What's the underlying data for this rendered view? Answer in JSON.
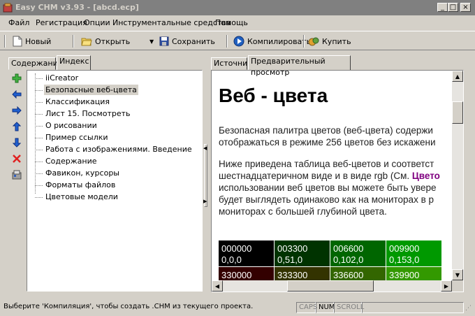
{
  "window": {
    "title": "Easy CHM v3.93 - [abcd.ecp]",
    "minimize_glyph": "_",
    "maximize_glyph": "□",
    "close_glyph": "×",
    "title_color": "#808080"
  },
  "menu": {
    "items": [
      {
        "label": "Файл"
      },
      {
        "label": "Регистрация"
      },
      {
        "label": "Опции"
      },
      {
        "label": "Инструментальные средства"
      },
      {
        "label": "Помощь"
      }
    ]
  },
  "toolbar": {
    "new_label": "Новый",
    "open_label": "Открыть",
    "save_label": "Сохранить",
    "compile_label": "Компилировать",
    "buy_label": "Купить"
  },
  "left_pane": {
    "tabs": [
      {
        "label": "Содержание",
        "active": false
      },
      {
        "label": "Индекс",
        "active": true
      }
    ],
    "side_buttons": [
      {
        "icon": "add-icon"
      },
      {
        "icon": "arrow-left-icon"
      },
      {
        "icon": "arrow-right-icon"
      },
      {
        "icon": "arrow-up-icon"
      },
      {
        "icon": "arrow-down-icon"
      },
      {
        "icon": "delete-icon"
      },
      {
        "icon": "properties-icon"
      }
    ],
    "items": [
      {
        "label": "iiCreator",
        "selected": false
      },
      {
        "label": "Безопасные веб-цвета",
        "selected": true
      },
      {
        "label": "Классификация",
        "selected": false
      },
      {
        "label": "Лист 15. Посмотреть",
        "selected": false
      },
      {
        "label": "О рисовании",
        "selected": false
      },
      {
        "label": "Пример ссылки",
        "selected": false
      },
      {
        "label": "Работа с изображениями. Введение",
        "selected": false
      },
      {
        "label": "Содержание",
        "selected": false
      },
      {
        "label": "Фавикон, курсоры",
        "selected": false
      },
      {
        "label": "Форматы файлов",
        "selected": false
      },
      {
        "label": "Цветовые модели",
        "selected": false
      }
    ]
  },
  "right_pane": {
    "tabs": [
      {
        "label": "Источник",
        "active": false
      },
      {
        "label": "Предварительный просмотр",
        "active": true
      }
    ],
    "preview": {
      "heading": "Веб - цвета",
      "para1_line1": "Безопасная палитра цветов (веб-цвета) содержи",
      "para1_line2": "отображаться в режиме 256 цветов без искажени",
      "para2_line1": "Ниже приведена таблица веб-цветов и соответст",
      "para2_line2_pre": "шестнадцатеричном виде и в виде rgb (См. ",
      "para2_line2_link": "Цвето",
      "para2_line3": "использовании веб цветов вы можете быть увере",
      "para2_line4": "будет выглядеть одинаково как на мониторах в р",
      "para2_line5": "мониторах с большей глубиной цвета.",
      "table_row1": [
        {
          "hex": "000000",
          "rgb": "0,0,0",
          "color": "#000000"
        },
        {
          "hex": "003300",
          "rgb": "0,51,0",
          "color": "#003300"
        },
        {
          "hex": "006600",
          "rgb": "0,102,0",
          "color": "#006600"
        },
        {
          "hex": "009900",
          "rgb": "0,153,0",
          "color": "#009900"
        }
      ],
      "table_row2": [
        {
          "hex": "330000",
          "color": "#330000"
        },
        {
          "hex": "333300",
          "color": "#333300"
        },
        {
          "hex": "336600",
          "color": "#336600"
        },
        {
          "hex": "339900",
          "color": "#339900"
        }
      ]
    }
  },
  "status": {
    "message": "Выберите 'Компиляция', чтобы создать .CHM из текущего проекта.",
    "caps": "CAPS",
    "num": "NUM",
    "scroll": "SCROLL"
  }
}
